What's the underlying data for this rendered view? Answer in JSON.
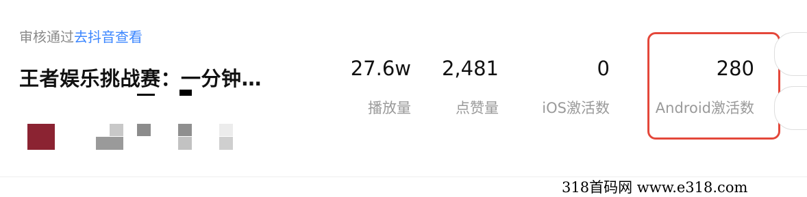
{
  "status": {
    "text": "审核通过",
    "link": "去抖音查看"
  },
  "video_title": "王者娱乐挑战赛：一分钟…",
  "stats": [
    {
      "value": "27.6w",
      "label": "播放量"
    },
    {
      "value": "2,481",
      "label": "点赞量"
    },
    {
      "value": "0",
      "label": "iOS激活数"
    },
    {
      "value": "280",
      "label": "Android激活数"
    }
  ],
  "highlight_color": "#e4473a",
  "link_color": "#3b86ff",
  "watermark": "318首码网  www.e318.com"
}
